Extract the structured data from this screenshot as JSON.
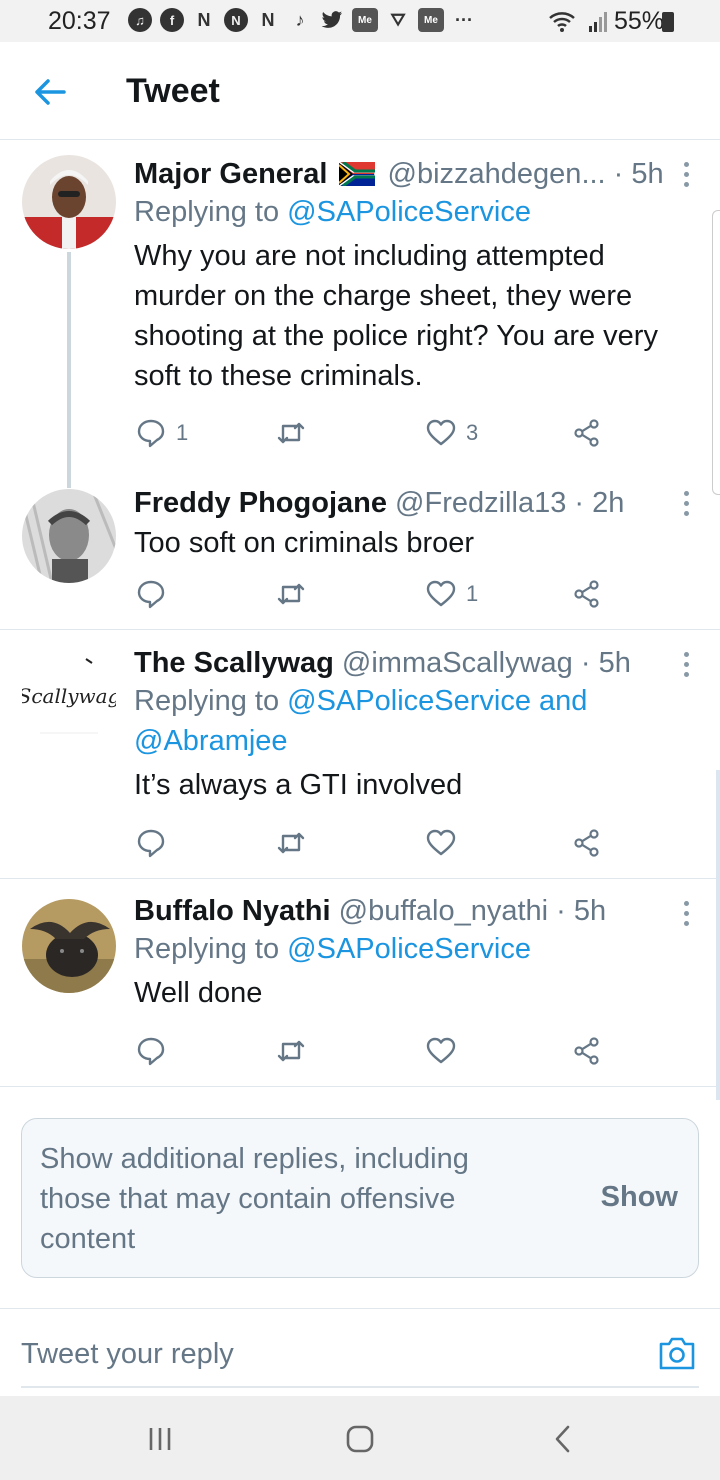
{
  "status_bar": {
    "time": "20:37",
    "battery": "55%",
    "app_icons": [
      "music-icon",
      "facebook-icon",
      "n-icon",
      "n-circle-icon",
      "n-icon",
      "tiktok-icon",
      "twitter-icon",
      "me-icon",
      "gift-icon",
      "me-icon",
      "more-icon"
    ],
    "app_glyphs": [
      "♫",
      "f",
      "N",
      "N",
      "N",
      "♪",
      "🐦",
      "Me",
      "⛛",
      "Me",
      "···"
    ]
  },
  "header": {
    "title": "Tweet"
  },
  "tweets": [
    {
      "name": "Major General",
      "handle": "@bizzahdegen... · 5h",
      "replying_prefix": "Replying to ",
      "replying_to": "@SAPoliceService",
      "text": "Why you are not including attempted murder on the charge sheet, they were shooting at the police right? You are very soft to these criminals.",
      "reply_count": "1",
      "like_count": "3"
    },
    {
      "name": "Freddy Phogojane",
      "handle": "@Fredzilla13 · 2h",
      "text": "Too soft on criminals broer",
      "reply_count": "",
      "like_count": "1"
    },
    {
      "name": "The Scallywag",
      "handle": "@immaScallywag · 5h",
      "replying_prefix": "Replying to ",
      "replying_to": "@SAPoliceService and",
      "replying_to_2": "@Abramjee",
      "text": "It’s always a GTI involved",
      "avatar_text": "Scallywag"
    },
    {
      "name": "Buffalo Nyathi",
      "handle": "@buffalo_nyathi · 5h",
      "replying_prefix": "Replying to ",
      "replying_to": "@SAPoliceService",
      "text": "Well done"
    }
  ],
  "show_more": {
    "text": "Show additional replies, including those that may contain offensive content",
    "button": "Show"
  },
  "reply_bar": {
    "placeholder": "Tweet your reply"
  },
  "colors": {
    "accent": "#1b95e0",
    "secondary_text": "#657786",
    "divider": "#e1e8ed"
  }
}
